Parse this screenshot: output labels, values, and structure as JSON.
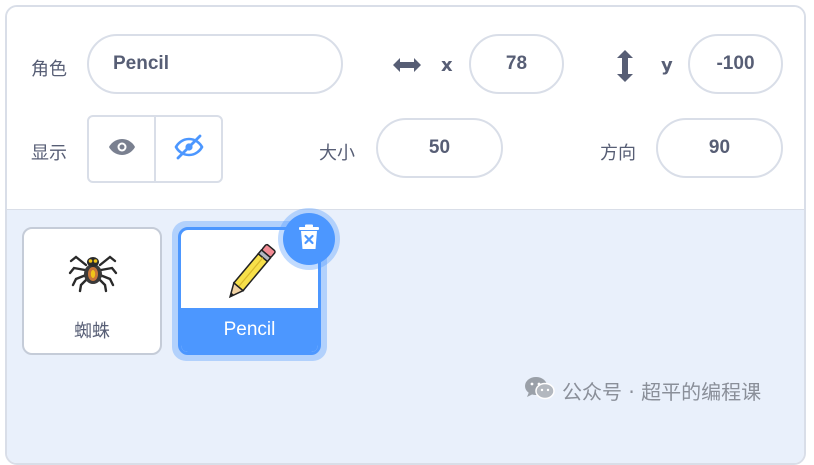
{
  "sprite_info": {
    "sprite_label": "角色",
    "sprite_name": "Pencil",
    "x_label": "x",
    "x_value": "78",
    "y_label": "y",
    "y_value": "-100",
    "show_label": "显示",
    "show_state": "hidden",
    "size_label": "大小",
    "size_value": "50",
    "direction_label": "方向",
    "direction_value": "90"
  },
  "sprites": [
    {
      "name": "蜘蛛",
      "icon": "spider-icon",
      "selected": false
    },
    {
      "name": "Pencil",
      "icon": "pencil-icon",
      "selected": true
    }
  ],
  "colors": {
    "accent": "#4c97ff",
    "text": "#575e75",
    "border": "#d9dee8",
    "sprite_pane_bg": "#e9f0fb"
  },
  "watermark": {
    "text": "公众号 · 超平的编程课",
    "icon": "wechat-icon"
  }
}
